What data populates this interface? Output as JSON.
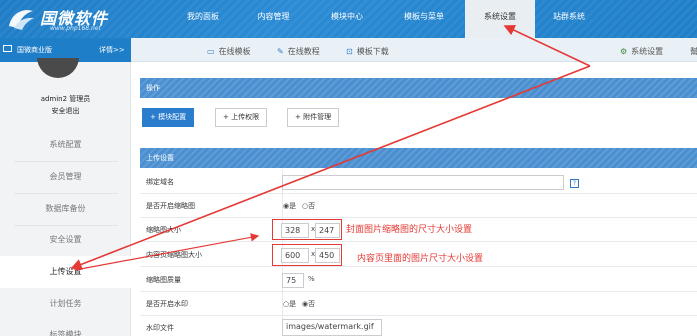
{
  "brand": {
    "name": "国微软件",
    "url": "www.php168.net"
  },
  "top_nav": [
    {
      "label": "我的面板",
      "active": false
    },
    {
      "label": "内容管理",
      "active": false
    },
    {
      "label": "模块中心",
      "active": false
    },
    {
      "label": "模板与菜单",
      "active": false
    },
    {
      "label": "系统设置",
      "active": true
    },
    {
      "label": "站群系统",
      "active": false
    }
  ],
  "sub_nav": {
    "edition": "国微商业版",
    "details": "详情>>",
    "items": [
      {
        "label": "在线模板",
        "icon": "monitor-icon"
      },
      {
        "label": "在线教程",
        "icon": "edit-icon"
      },
      {
        "label": "模板下载",
        "icon": "download-icon"
      },
      {
        "label": "系统设置",
        "icon": "gear-icon"
      },
      {
        "label": "幫",
        "icon": ""
      }
    ]
  },
  "user": {
    "name": "admin2 管理员",
    "logout": "安全退出"
  },
  "sidebar": [
    {
      "label": "系统配置",
      "active": false
    },
    {
      "label": "会员管理",
      "active": false
    },
    {
      "label": "数据库备份",
      "active": false
    },
    {
      "label": "安全设置",
      "active": false
    },
    {
      "label": "上传设置",
      "active": true
    },
    {
      "label": "计划任务",
      "active": false
    },
    {
      "label": "标签模块",
      "active": false
    }
  ],
  "operations": {
    "title": "操作",
    "buttons": [
      {
        "label": "+ 模块配置"
      },
      {
        "label": "+ 上传权限"
      },
      {
        "label": "+ 附件管理"
      }
    ]
  },
  "upload": {
    "title": "上传设置",
    "rows": {
      "bind_domain": {
        "label": "绑定域名",
        "value": "",
        "help": "?"
      },
      "thumb_enable": {
        "label": "是否开启缩略图",
        "yes": "是",
        "no": "否",
        "selected": "yes"
      },
      "thumb_size": {
        "label": "缩略图大小",
        "width": "328",
        "height": "247",
        "sep": "x"
      },
      "content_thumb_size": {
        "label": "内容页缩略图大小",
        "width": "600",
        "height": "450",
        "sep": "x"
      },
      "thumb_quality": {
        "label": "缩略图质量",
        "value": "75",
        "unit": "%"
      },
      "watermark_enable": {
        "label": "是否开启水印",
        "yes": "是",
        "no": "否",
        "selected": "no"
      },
      "watermark_file": {
        "label": "水印文件",
        "value": "images/watermark.gif"
      }
    }
  },
  "annotations": {
    "cover_note": "封面图片缩略图的尺寸大小设置",
    "content_note": "内容页里面的图片尺寸大小设置",
    "color": "#e53935"
  }
}
